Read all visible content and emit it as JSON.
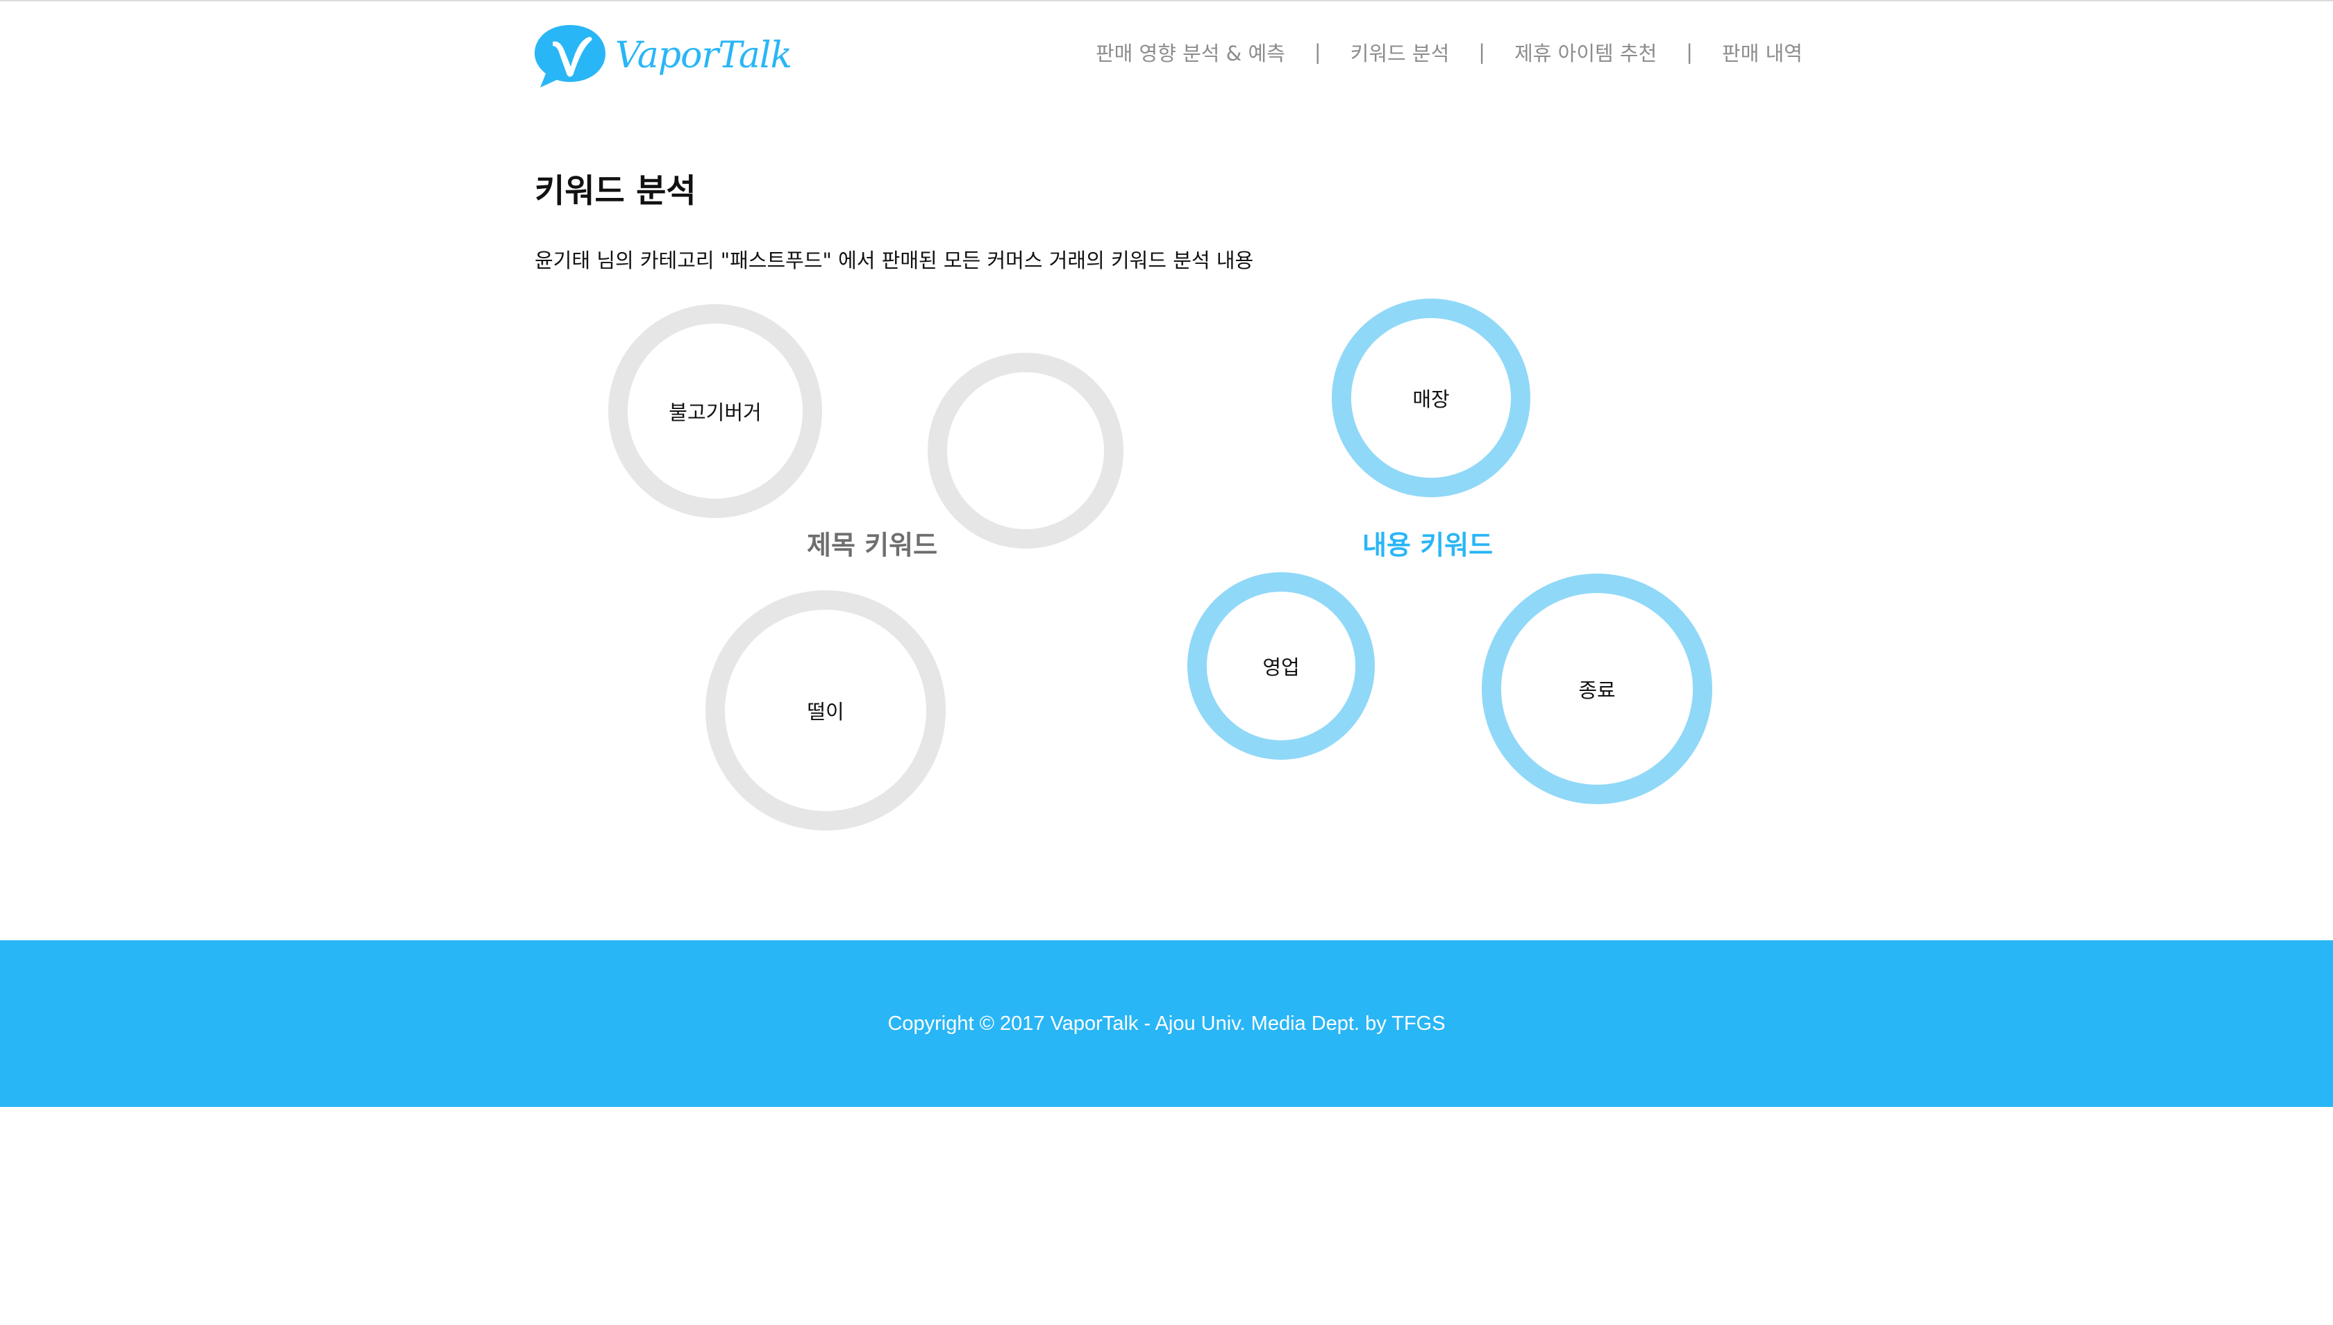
{
  "header": {
    "logo_text": "VaporTalk",
    "nav": [
      {
        "label": "판매 영향 분석 & 예측"
      },
      {
        "label": "키워드 분석"
      },
      {
        "label": "제휴 아이템 추천"
      },
      {
        "label": "판매 내역"
      }
    ],
    "separator": "|"
  },
  "main": {
    "title": "키워드 분석",
    "description": "윤기태 님의 카테고리 \"패스트푸드\" 에서 판매된 모든 커머스 거래의 키워드 분석 내용",
    "title_group": {
      "label": "제목 키워드",
      "keywords": [
        "불고기버거",
        "",
        "떨이"
      ]
    },
    "content_group": {
      "label": "내용 키워드",
      "keywords": [
        "매장",
        "영업",
        "종료"
      ]
    }
  },
  "footer": {
    "copyright": "Copyright © 2017 VaporTalk - Ajou Univ. Media Dept. by TFGS"
  },
  "colors": {
    "accent": "#29b6f6",
    "bubble_blue": "#90d8f8",
    "bubble_gray": "#e6e6e6",
    "nav_text": "#8c8c8c"
  }
}
